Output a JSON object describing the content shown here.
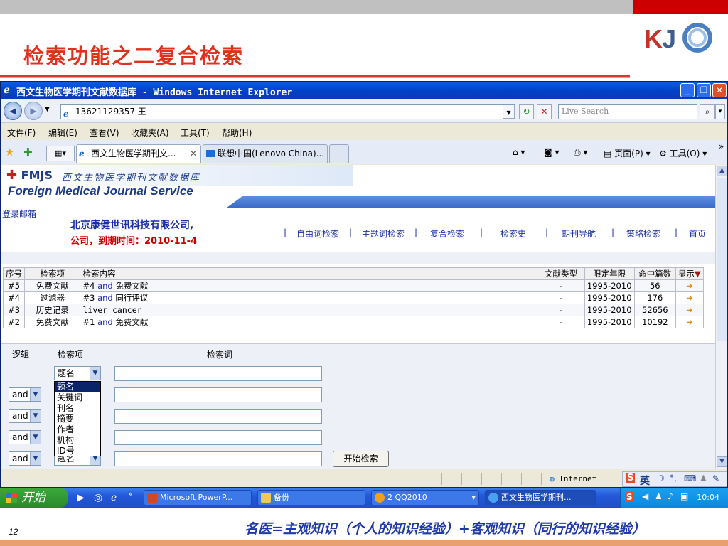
{
  "slide": {
    "title": "检索功能之二复合检索",
    "logo_text_k": "K",
    "logo_text_j": "J",
    "page_number": "12",
    "footnote": "名医=主观知识（个人的知识经验）+客观知识（同行的知识经验）",
    "colors": {
      "title": "#e0301e",
      "accent_red": "#cc0000",
      "footnote": "#1f3aa8"
    }
  },
  "window": {
    "title": "西文生物医学期刊文献数据库 - Windows Internet Explorer",
    "address": "13621129357 王",
    "search_placeholder": "Live Search",
    "menu": [
      "文件(F)",
      "编辑(E)",
      "查看(V)",
      "收藏夹(A)",
      "工具(T)",
      "帮助(H)"
    ],
    "tabs": [
      {
        "label": "西文生物医学期刊文...",
        "active": true
      },
      {
        "label": "联想中国(Lenovo China)...",
        "active": false
      }
    ],
    "toolbar_right": {
      "page": "页面(P)",
      "tools": "工具(O)"
    }
  },
  "site": {
    "brand": "FMJS",
    "brand_cn": "西文生物医学期刊文献数据库",
    "brand_en": "Foreign Medical Journal Service",
    "login_link": "登录邮箱",
    "company_line1": "北京康健世讯科技有限公司,",
    "company_line2": "公司，到期时间：2010-11-4",
    "nav": [
      "自由词检索",
      "主题词检索",
      "复合检索",
      "检索史",
      "期刊导航",
      "策略检索",
      "首页"
    ]
  },
  "history": {
    "headers": [
      "序号",
      "检索项",
      "检索内容",
      "文献类型",
      "限定年限",
      "命中篇数",
      "显示"
    ],
    "rows": [
      {
        "no": "#5",
        "field": "免费文献",
        "pre": "#4",
        "op": "and",
        "post": "免费文献",
        "type": "-",
        "years": "1995-2010",
        "hits": "56"
      },
      {
        "no": "#4",
        "field": "过滤器",
        "pre": "#3",
        "op": "and",
        "post": "同行评议",
        "type": "-",
        "years": "1995-2010",
        "hits": "176"
      },
      {
        "no": "#3",
        "field": "历史记录",
        "pre": "liver cancer",
        "op": "",
        "post": "",
        "type": "-",
        "years": "1995-2010",
        "hits": "52656"
      },
      {
        "no": "#2",
        "field": "免费文献",
        "pre": "#1",
        "op": "and",
        "post": "免费文献",
        "type": "-",
        "years": "1995-2010",
        "hits": "10192"
      }
    ]
  },
  "advanced": {
    "label_logic": "逻辑",
    "label_field": "检索项",
    "label_term": "检索词",
    "first_field": "题名",
    "logic_value": "and",
    "last_field": "题名",
    "dropdown_options": [
      "题名",
      "关键词",
      "刊名",
      "摘要",
      "作者",
      "机构",
      "ID号"
    ],
    "search_button": "开始检索"
  },
  "statusbar": {
    "zone": "Internet",
    "ime_lang": "英"
  },
  "taskbar": {
    "start": "开始",
    "items": [
      {
        "label": "Microsoft PowerP..."
      },
      {
        "label": "备份"
      },
      {
        "label": "2 QQ2010"
      },
      {
        "label": "西文生物医学期刊..."
      }
    ],
    "clock": "10:04"
  }
}
